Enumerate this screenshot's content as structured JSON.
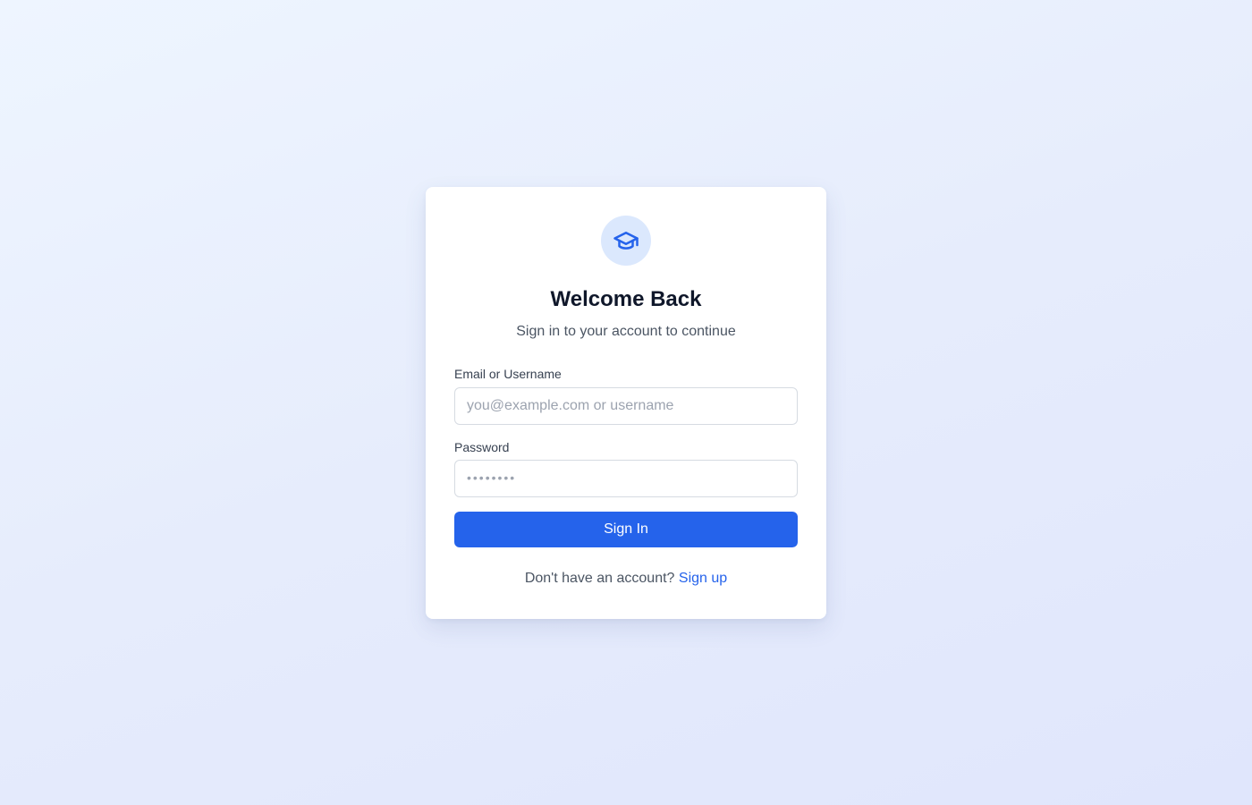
{
  "login": {
    "icon": "graduation-cap-icon",
    "title": "Welcome Back",
    "subtitle": "Sign in to your account to continue",
    "email_label": "Email or Username",
    "email_placeholder": "you@example.com or username",
    "email_value": "",
    "password_label": "Password",
    "password_placeholder": "••••••••",
    "password_value": "",
    "submit_label": "Sign In",
    "footer_text": "Don't have an account?",
    "signup_link": "Sign up"
  },
  "colors": {
    "accent": "#2563eb",
    "icon_bg": "#dbe8fd",
    "background": "#e6ecfc"
  }
}
